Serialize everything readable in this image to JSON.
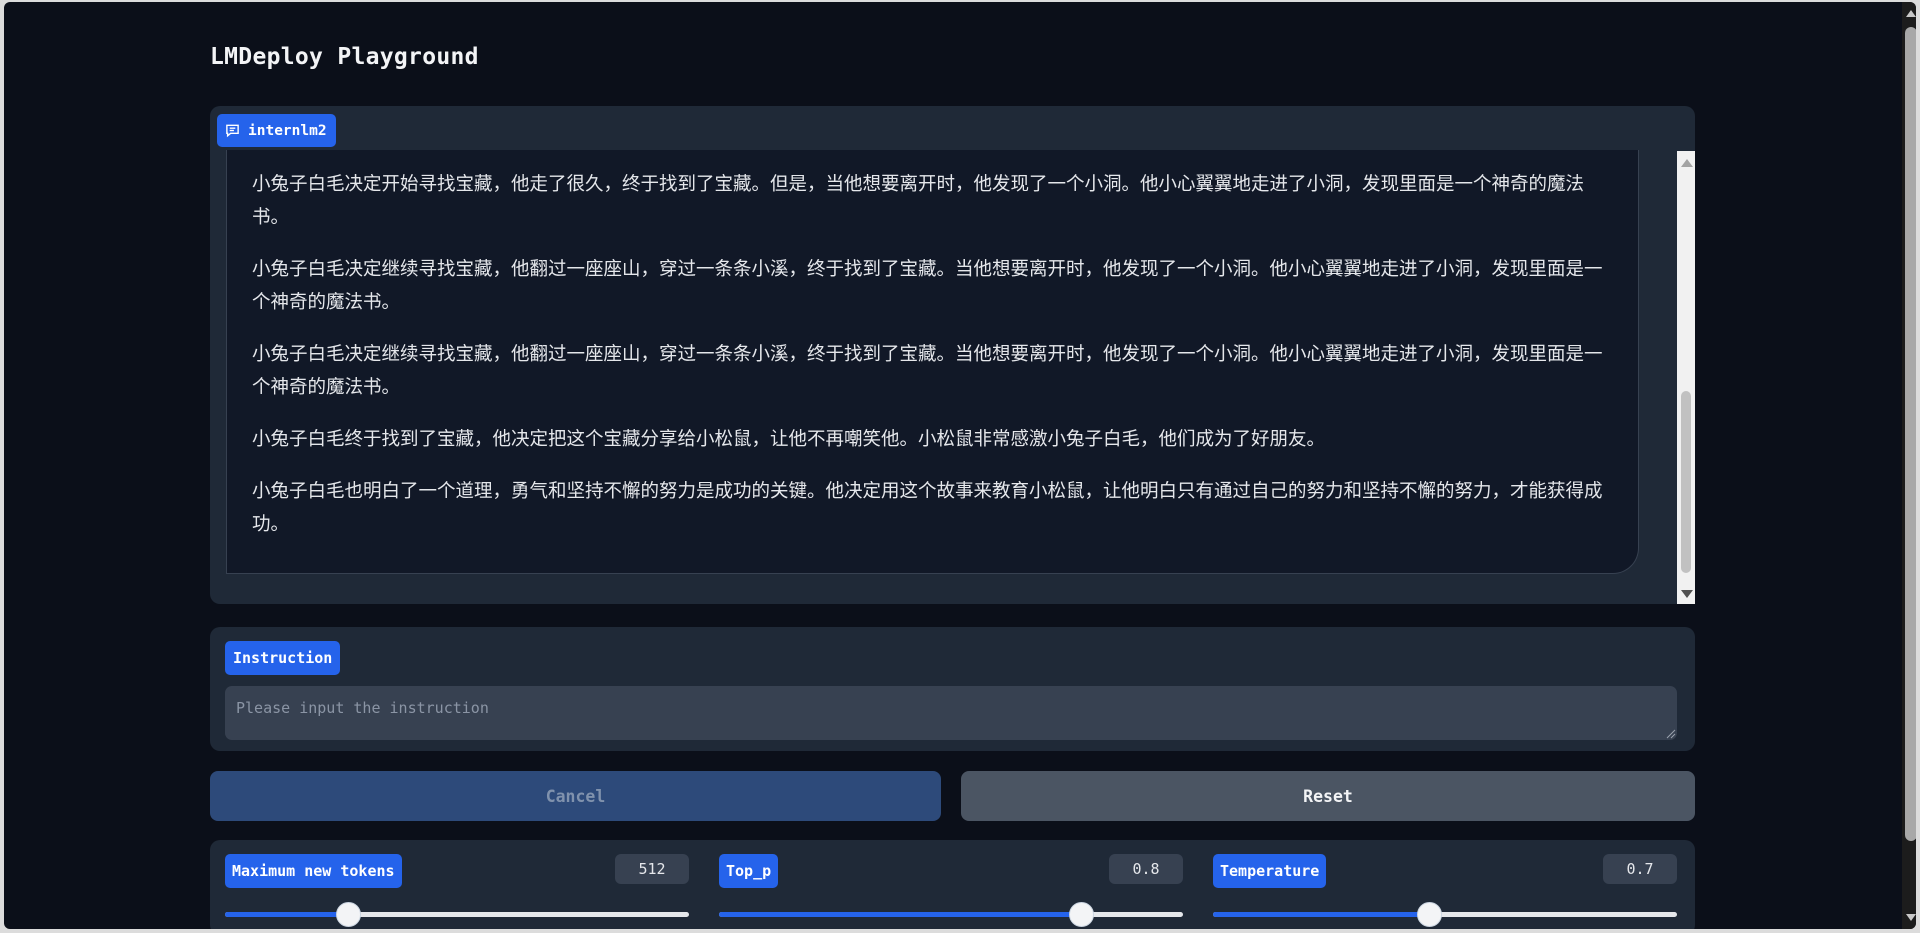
{
  "app": {
    "title": "LMDeploy Playground"
  },
  "chat": {
    "label": "internlm2",
    "label_icon": "chat-icon",
    "messages": [
      "小兔子白毛决定开始寻找宝藏，他走了很久，终于找到了宝藏。但是，当他想要离开时，他发现了一个小洞。他小心翼翼地走进了小洞，发现里面是一个神奇的魔法书。",
      "小兔子白毛决定继续寻找宝藏，他翻过一座座山，穿过一条条小溪，终于找到了宝藏。当他想要离开时，他发现了一个小洞。他小心翼翼地走进了小洞，发现里面是一个神奇的魔法书。",
      "小兔子白毛决定继续寻找宝藏，他翻过一座座山，穿过一条条小溪，终于找到了宝藏。当他想要离开时，他发现了一个小洞。他小心翼翼地走进了小洞，发现里面是一个神奇的魔法书。",
      "小兔子白毛终于找到了宝藏，他决定把这个宝藏分享给小松鼠，让他不再嘲笑他。小松鼠非常感激小兔子白毛，他们成为了好朋友。",
      "小兔子白毛也明白了一个道理，勇气和坚持不懈的努力是成功的关键。他决定用这个故事来教育小松鼠，让他明白只有通过自己的努力和坚持不懈的努力，才能获得成功。"
    ]
  },
  "instruction": {
    "label": "Instruction",
    "value": "",
    "placeholder": "Please input the instruction"
  },
  "buttons": {
    "cancel": "Cancel",
    "reset": "Reset"
  },
  "sliders": [
    {
      "label": "Maximum new tokens",
      "value": "512",
      "fraction": 0.265
    },
    {
      "label": "Top_p",
      "value": "0.8",
      "fraction": 0.78
    },
    {
      "label": "Temperature",
      "value": "0.7",
      "fraction": 0.465
    }
  ],
  "colors": {
    "background": "#0b0f19",
    "panel": "#1f2937",
    "accent": "#2563eb",
    "input": "#374151",
    "cancel_bg": "#2d4a7a",
    "reset_bg": "#4b5563"
  }
}
